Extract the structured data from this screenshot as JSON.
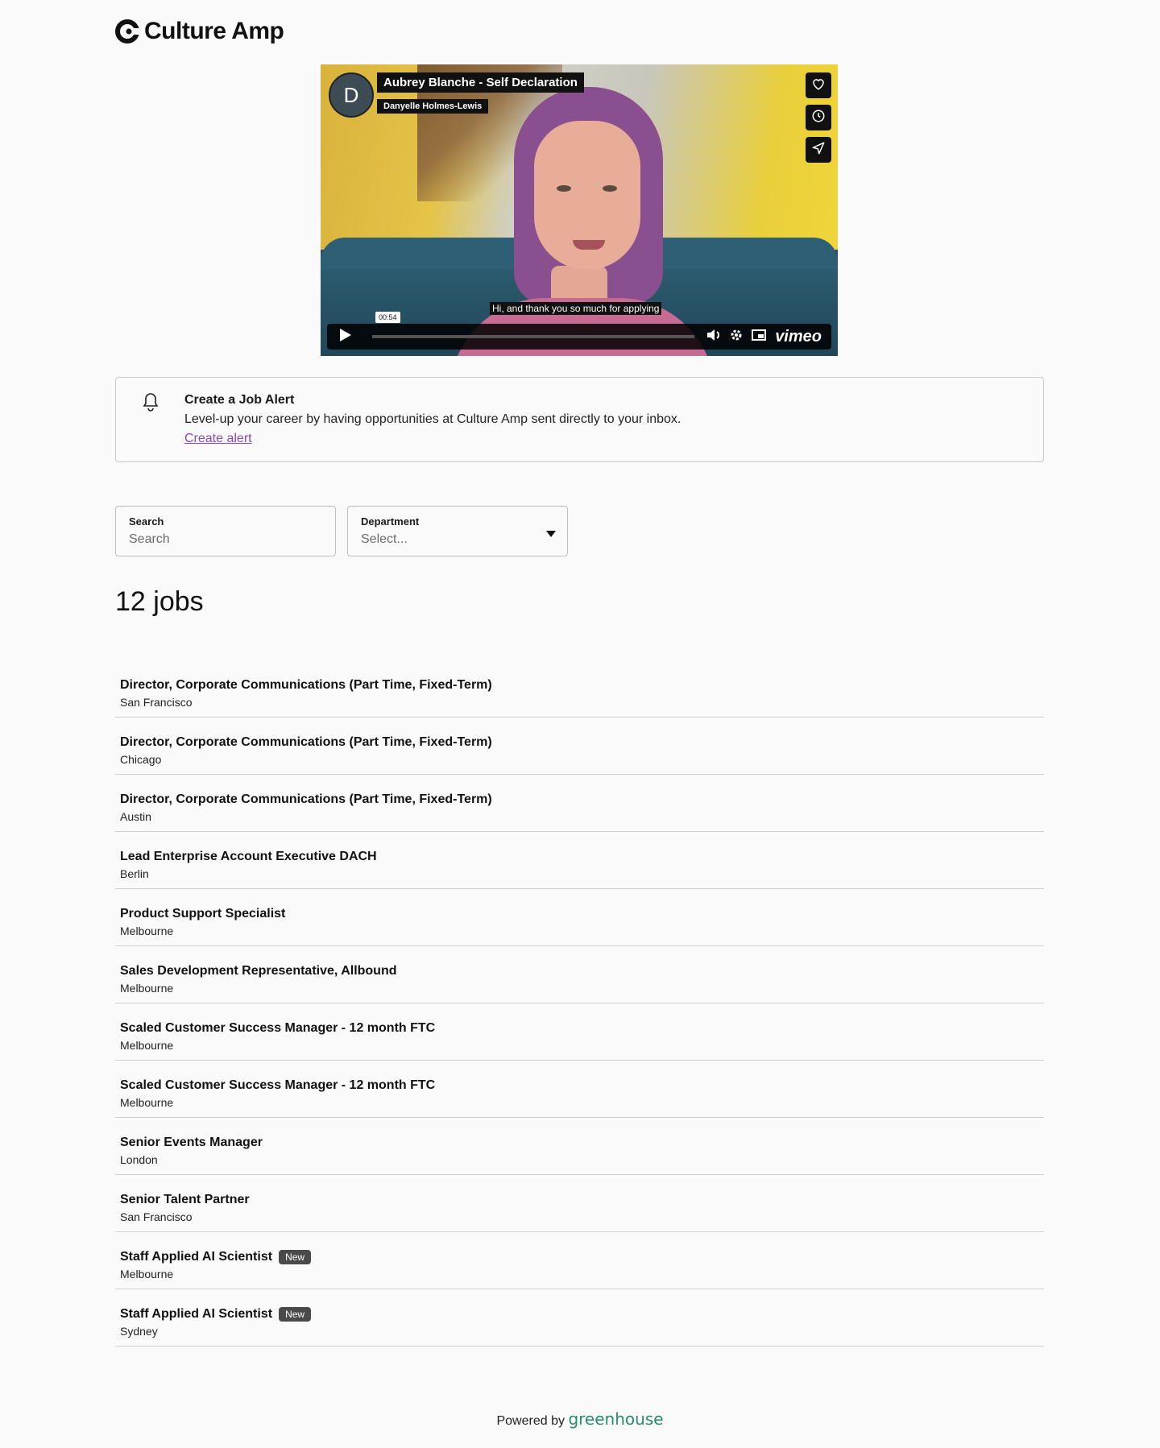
{
  "brand": {
    "name": "Culture Amp"
  },
  "video": {
    "avatar_letter": "D",
    "title": "Aubrey Blanche - Self Declaration",
    "subtitle": "Danyelle Holmes-Lewis",
    "caption": "Hi, and thank you so much for applying",
    "time": "00:54",
    "player_brand": "vimeo",
    "icons": [
      "heart-icon",
      "clock-icon",
      "send-icon",
      "play-icon",
      "volume-icon",
      "settings-icon",
      "pip-icon"
    ]
  },
  "alert": {
    "title": "Create a Job Alert",
    "description": "Level-up your career by having opportunities at Culture Amp sent directly to your inbox.",
    "link": "Create alert",
    "link_color": "#8a48b3"
  },
  "filters": {
    "search": {
      "label": "Search",
      "placeholder": "Search"
    },
    "department": {
      "label": "Department",
      "placeholder": "Select..."
    }
  },
  "jobs_count": "12 jobs",
  "jobs": [
    {
      "title": "Director, Corporate Communications (Part Time, Fixed-Term)",
      "location": "San Francisco",
      "badge": ""
    },
    {
      "title": "Director, Corporate Communications (Part Time, Fixed-Term)",
      "location": "Chicago",
      "badge": ""
    },
    {
      "title": "Director, Corporate Communications (Part Time, Fixed-Term)",
      "location": "Austin",
      "badge": ""
    },
    {
      "title": "Lead Enterprise Account Executive DACH",
      "location": "Berlin",
      "badge": ""
    },
    {
      "title": "Product Support Specialist",
      "location": "Melbourne",
      "badge": ""
    },
    {
      "title": "Sales Development Representative, Allbound",
      "location": "Melbourne",
      "badge": ""
    },
    {
      "title": "Scaled Customer Success Manager - 12 month FTC",
      "location": "Melbourne",
      "badge": ""
    },
    {
      "title": "Scaled Customer Success Manager - 12 month FTC",
      "location": "Melbourne",
      "badge": ""
    },
    {
      "title": "Senior Events Manager",
      "location": "London",
      "badge": ""
    },
    {
      "title": "Senior Talent Partner",
      "location": "San Francisco",
      "badge": ""
    },
    {
      "title": "Staff Applied AI Scientist",
      "location": "Melbourne",
      "badge": "New"
    },
    {
      "title": "Staff Applied AI Scientist",
      "location": "Sydney",
      "badge": "New"
    }
  ],
  "footer": {
    "prefix": "Powered by",
    "brand": "greenhouse",
    "brand_color": "#2a8a6e"
  }
}
